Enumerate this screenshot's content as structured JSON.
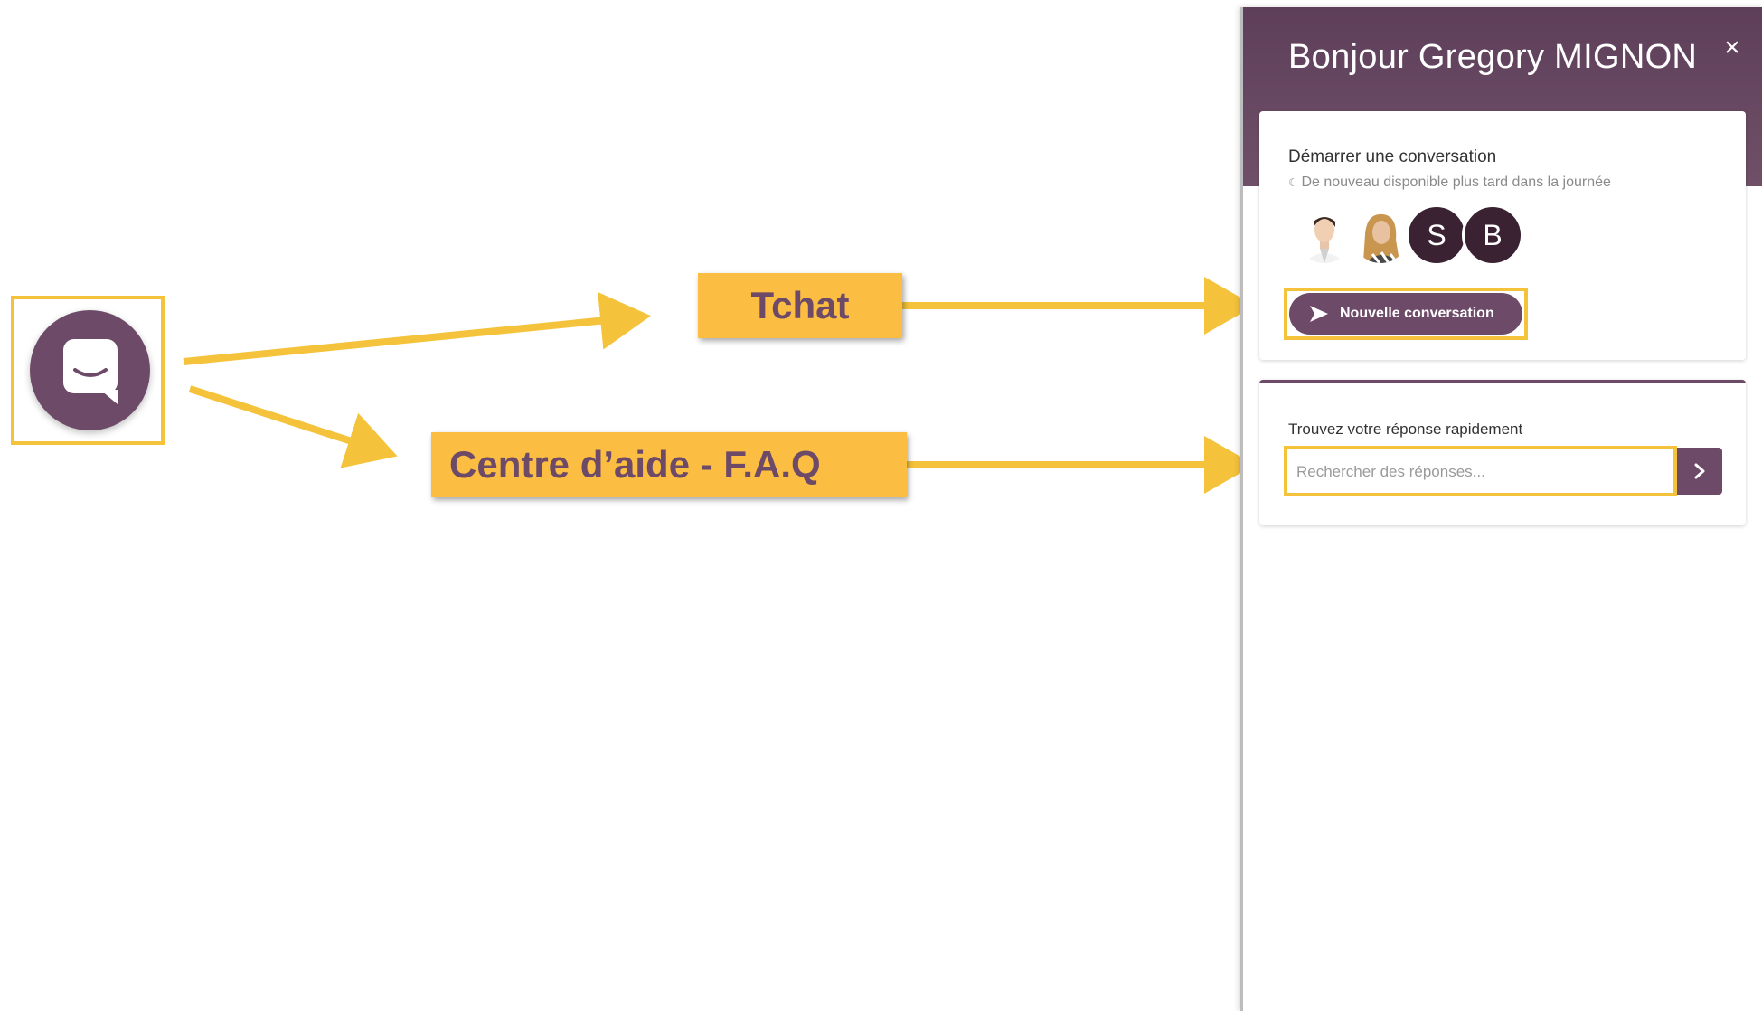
{
  "annotations": {
    "tchat": "Tchat",
    "faq": "Centre d’aide - F.A.Q"
  },
  "colors": {
    "brand": "#6d4a67",
    "highlight": "#f5c33b",
    "callout_bg": "#fbbd42"
  },
  "panel": {
    "greeting": "Bonjour Gregory MIGNON",
    "close_symbol": "×",
    "conversation": {
      "title": "Démarrer une conversation",
      "availability": "De nouveau disponible plus tard dans la journée",
      "avatars": [
        "S",
        "B"
      ],
      "new_button": "Nouvelle conversation"
    },
    "search": {
      "title": "Trouvez votre réponse rapidement",
      "placeholder": "Rechercher des réponses..."
    }
  }
}
